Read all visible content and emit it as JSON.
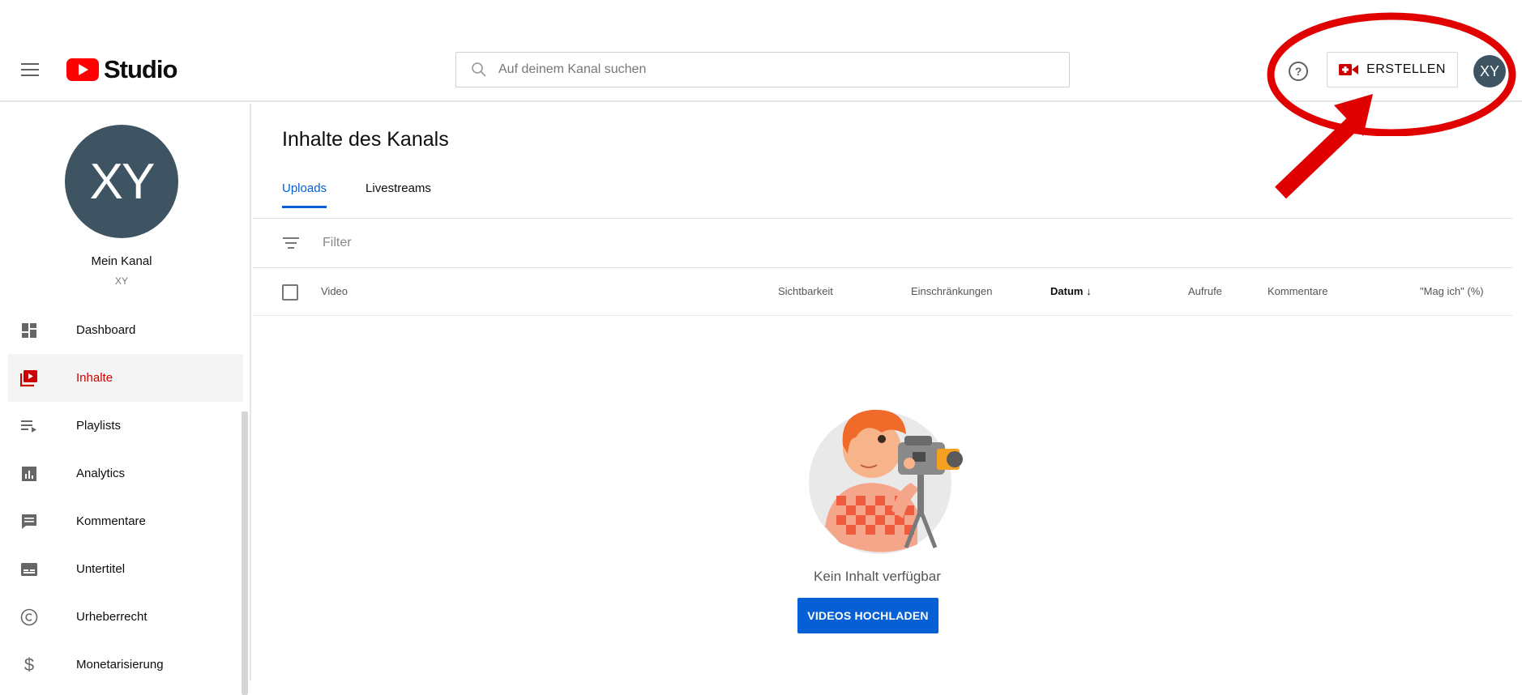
{
  "app": {
    "logo_text": "Studio",
    "brand_color": "#ff0000",
    "accent_color": "#065fd4"
  },
  "header": {
    "search": {
      "placeholder": "Auf deinem Kanal suchen"
    },
    "help_icon": "help-circle-icon",
    "create_button": {
      "label": "ERSTELLEN",
      "icon": "video-create-icon"
    },
    "avatar_initials": "XY"
  },
  "sidebar": {
    "avatar_initials": "XY",
    "channel_name": "Mein Kanal",
    "channel_handle": "XY",
    "items": [
      {
        "label": "Dashboard",
        "icon": "dashboard-icon",
        "active": false
      },
      {
        "label": "Inhalte",
        "icon": "content-icon",
        "active": true
      },
      {
        "label": "Playlists",
        "icon": "playlists-icon",
        "active": false
      },
      {
        "label": "Analytics",
        "icon": "analytics-icon",
        "active": false
      },
      {
        "label": "Kommentare",
        "icon": "comments-icon",
        "active": false
      },
      {
        "label": "Untertitel",
        "icon": "subtitles-icon",
        "active": false
      },
      {
        "label": "Urheberrecht",
        "icon": "copyright-icon",
        "active": false
      },
      {
        "label": "Monetarisierung",
        "icon": "dollar-icon",
        "active": false
      }
    ]
  },
  "main": {
    "title": "Inhalte des Kanals",
    "tabs": [
      {
        "label": "Uploads",
        "active": true
      },
      {
        "label": "Livestreams",
        "active": false
      }
    ],
    "filter": {
      "placeholder": "Filter"
    },
    "columns": [
      {
        "label": "Video"
      },
      {
        "label": "Sichtbarkeit"
      },
      {
        "label": "Einschränkungen"
      },
      {
        "label": "Datum",
        "sorted": "desc"
      },
      {
        "label": "Aufrufe"
      },
      {
        "label": "Kommentare"
      },
      {
        "label": "\"Mag ich\" (%)"
      }
    ],
    "empty_state": {
      "text": "Kein Inhalt verfügbar",
      "button_label": "VIDEOS HOCHLADEN"
    }
  },
  "annotation": {
    "color": "#e00000"
  }
}
